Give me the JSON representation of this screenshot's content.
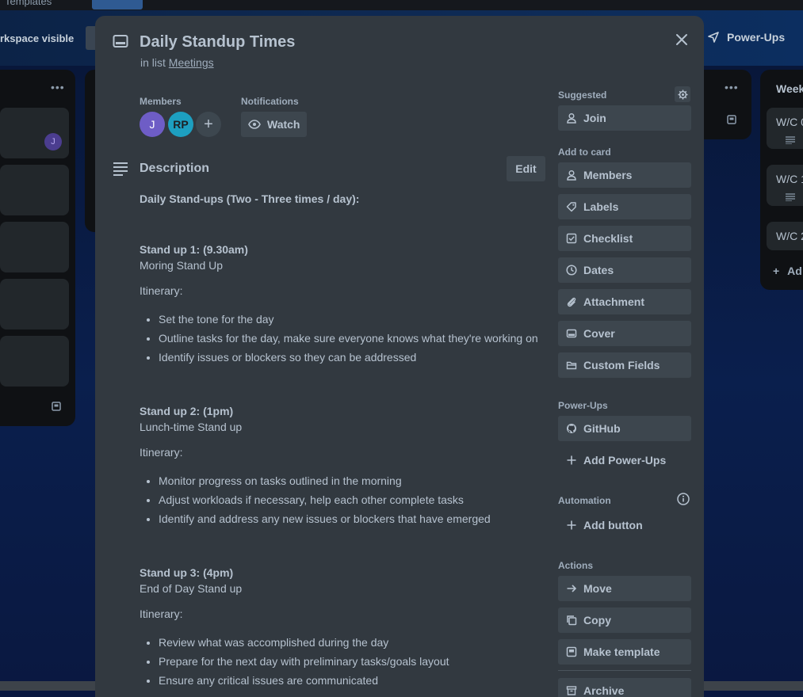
{
  "background": {
    "templates_label": "Templates",
    "workspace_label": "rkspace visible",
    "powerups_label": "Power-Ups",
    "right_list_title": "Week",
    "right_cards": [
      "W/C 0",
      "W/C 1",
      "W/C 2"
    ],
    "add_card_label": "Ad",
    "member_initial": "J"
  },
  "card": {
    "title": "Daily Standup Times",
    "in_list_prefix": "in list",
    "list_name": "Meetings",
    "members_label": "Members",
    "notifications_label": "Notifications",
    "members": [
      {
        "initials": "J",
        "color": "#6e5dc6"
      },
      {
        "initials": "RP",
        "color": "#1d9fc0"
      }
    ],
    "add_member_symbol": "+",
    "watch_label": "Watch"
  },
  "description": {
    "title": "Description",
    "edit_label": "Edit",
    "intro": "Daily Stand-ups (Two - Three times / day):",
    "itinerary_label": "Itinerary:",
    "standups": [
      {
        "heading": "Stand up 1: (9.30am)",
        "subtitle": "Moring Stand Up",
        "items": [
          "Set the tone for the day",
          "Outline tasks for the day, make sure everyone knows what they're working on",
          "Identify issues or blockers so they can be addressed"
        ]
      },
      {
        "heading": "Stand up 2: (1pm)",
        "subtitle": "Lunch-time Stand up",
        "items": [
          "Monitor progress on tasks outlined in the morning",
          "Adjust workloads if necessary, help each other complete tasks",
          "Identify and address any new issues or blockers that have emerged"
        ]
      },
      {
        "heading": "Stand up 3: (4pm)",
        "subtitle": "End of Day Stand up",
        "items": [
          "Review what was accomplished during the day",
          "Prepare for the next day with preliminary tasks/goals layout",
          "Ensure any critical issues are communicated"
        ]
      }
    ]
  },
  "sidebar": {
    "suggested_label": "Suggested",
    "join_label": "Join",
    "add_to_card_label": "Add to card",
    "add_to_card": [
      "Members",
      "Labels",
      "Checklist",
      "Dates",
      "Attachment",
      "Cover",
      "Custom Fields"
    ],
    "powerups_label": "Power-Ups",
    "github_label": "GitHub",
    "add_powerups_label": "Add Power-Ups",
    "automation_label": "Automation",
    "add_button_label": "Add button",
    "actions_label": "Actions",
    "actions": [
      "Move",
      "Copy",
      "Make template",
      "Archive"
    ]
  },
  "colors": {
    "modal_bg": "#323940",
    "button_bg": "#3d464e",
    "text": "#b6c2cf",
    "muted": "#9fadbc"
  }
}
